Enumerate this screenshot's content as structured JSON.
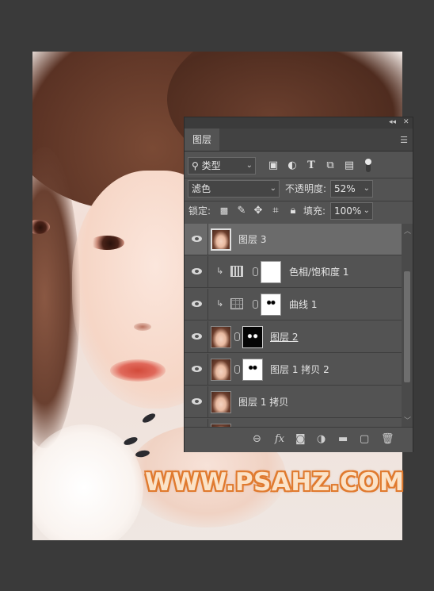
{
  "watermark": "WWW.PSAHZ.COM",
  "panel": {
    "title_controls": [
      "◂◂",
      "✕"
    ],
    "tab_label": "图层",
    "menu_icon": "hamburger-menu-icon",
    "filter": {
      "icon": "search-icon",
      "value": "类型"
    },
    "filter_icons": [
      "image-filter-icon",
      "adjustment-filter-icon",
      "type-filter-icon",
      "shape-filter-icon",
      "smart-object-filter-icon",
      "toggle-filter-icon"
    ],
    "blend_mode": "滤色",
    "opacity_label": "不透明度:",
    "opacity_value": "52%",
    "lock_label": "锁定:",
    "fill_label": "填充:",
    "fill_value": "100%",
    "lock_icons": [
      "lock-transparent-icon",
      "lock-paint-icon",
      "lock-move-icon",
      "lock-artboard-icon",
      "lock-all-icon"
    ],
    "layers": [
      {
        "name": "图层 3",
        "selected": true
      },
      {
        "name": "色相/饱和度 1",
        "selected": false
      },
      {
        "name": "曲线 1",
        "selected": false
      },
      {
        "name": "图层 2",
        "selected": false
      },
      {
        "name": "图层 1 拷贝 2",
        "selected": false
      },
      {
        "name": "图层 1 拷贝",
        "selected": false
      }
    ],
    "bottom_icons": [
      "link-icon",
      "fx-icon",
      "add-mask-icon",
      "adjustment-layer-icon",
      "group-folder-icon",
      "new-layer-icon",
      "trash-icon"
    ]
  }
}
